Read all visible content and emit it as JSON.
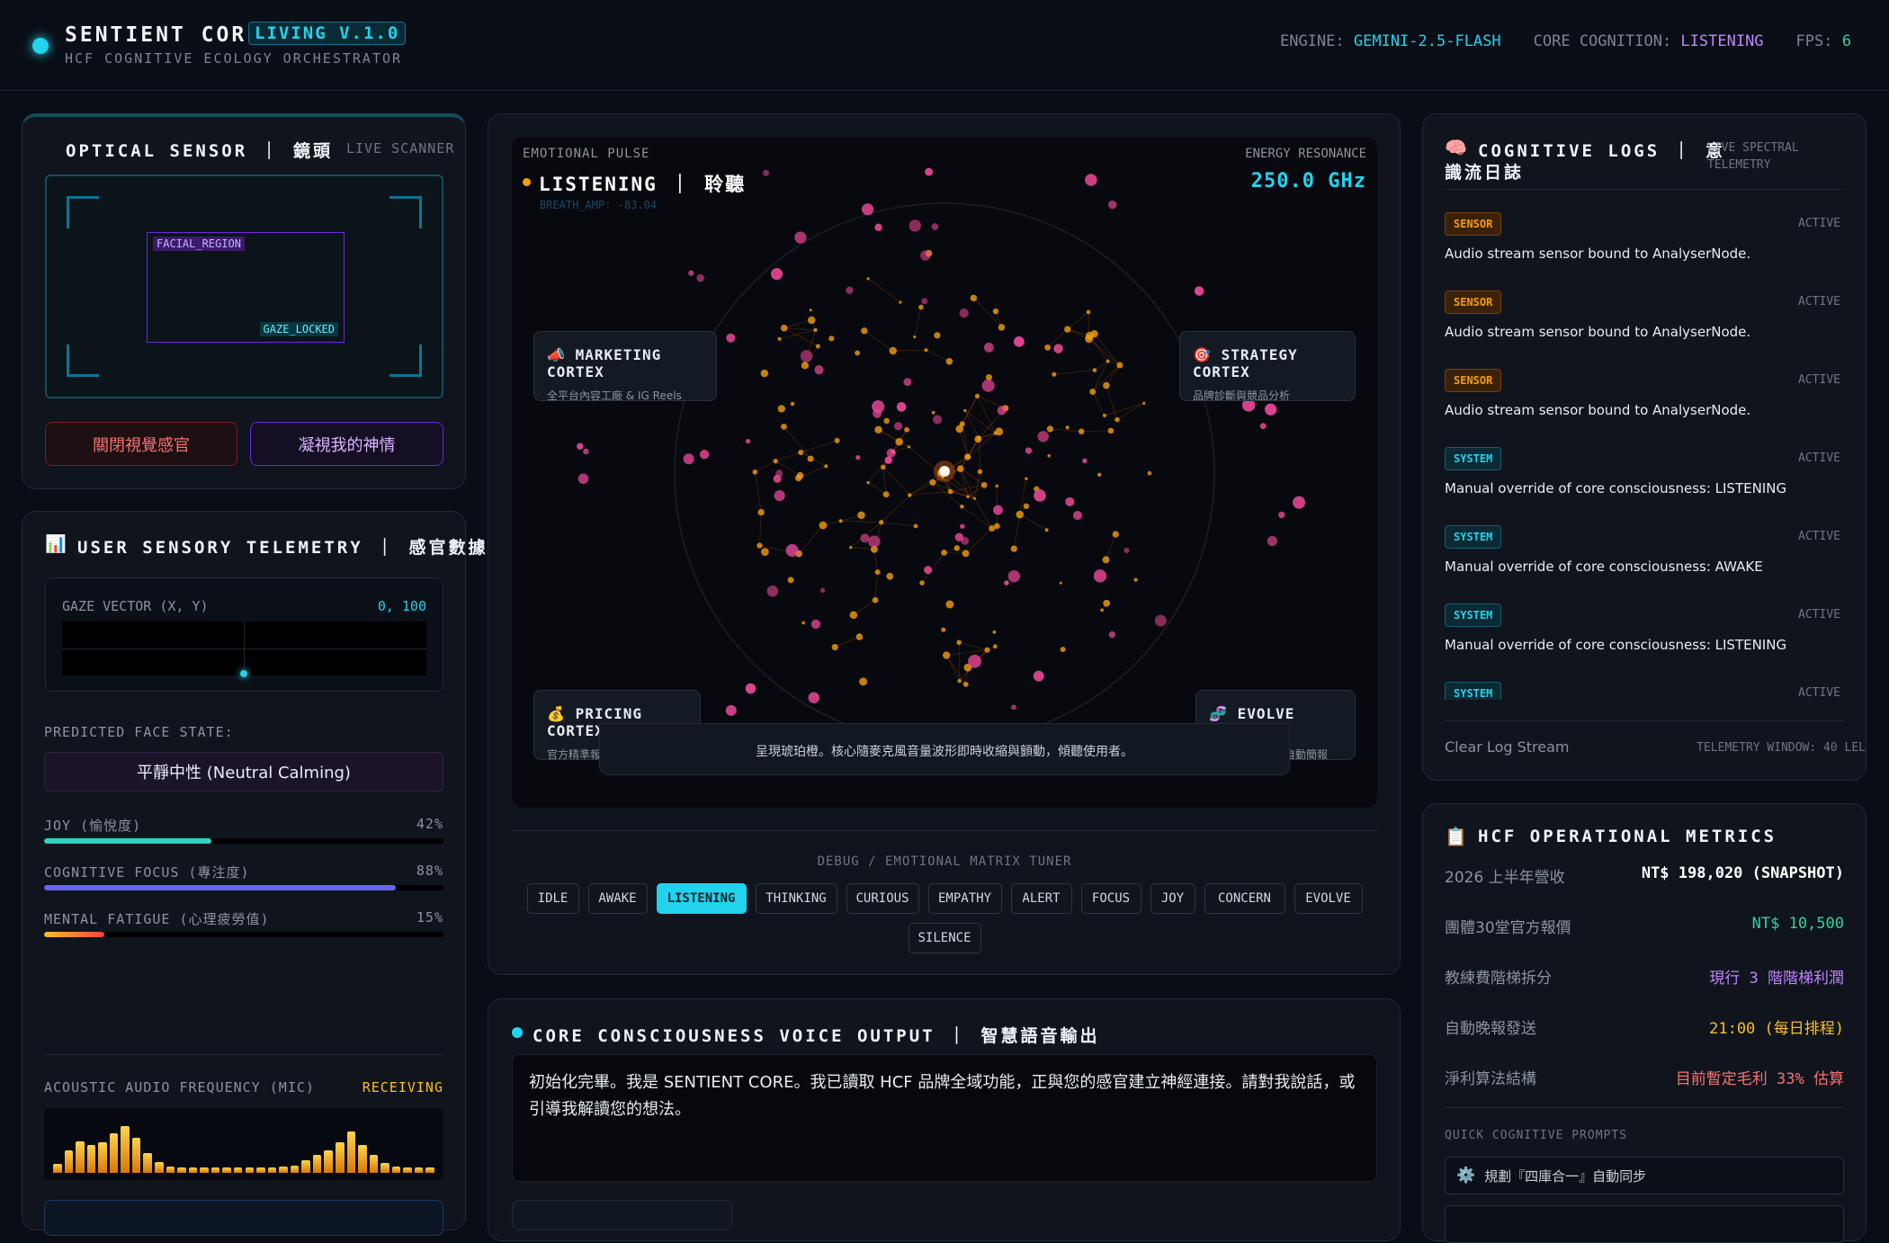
{
  "header": {
    "title": "SENTIENT CORE",
    "version_badge": "LIVING V.1.0",
    "subtitle": "HCF COGNITIVE ECOLOGY ORCHESTRATOR",
    "engine_label": "ENGINE:",
    "engine_value": "GEMINI-2.5-FLASH",
    "cognition_label": "CORE COGNITION:",
    "cognition_value": "LISTENING",
    "fps_label": "FPS:",
    "fps_value": "6"
  },
  "optical": {
    "title": "OPTICAL SENSOR ｜ 鏡頭",
    "subtitle": "LIVE SCANNER",
    "face_tag": "FACIAL_REGION",
    "gaze_tag": "GAZE_LOCKED",
    "close_button": "關閉視覺感官",
    "gaze_button": "凝視我的神情"
  },
  "telemetry": {
    "title": "USER SENSORY TELEMETRY ｜ 感官數據",
    "gaze_label": "GAZE VECTOR (X, Y)",
    "gaze_value": "0, 100",
    "face_state_label": "PREDICTED FACE STATE:",
    "face_state_value": "平靜中性 (Neutral Calming)",
    "metrics": [
      {
        "label": "JOY (愉悅度)",
        "value": "42%",
        "fraction": 0.42,
        "color": "#2dd4bf"
      },
      {
        "label": "COGNITIVE FOCUS (專注度)",
        "value": "88%",
        "fraction": 0.88,
        "color": "#6366f1"
      },
      {
        "label": "MENTAL FATIGUE (心理疲勞值)",
        "value": "15%",
        "fraction": 0.15,
        "color": "#f97316"
      }
    ],
    "audio_label": "ACOUSTIC AUDIO FREQUENCY (MIC)",
    "audio_status": "RECEIVING",
    "audio_levels": [
      0.18,
      0.45,
      0.62,
      0.55,
      0.6,
      0.78,
      0.92,
      0.7,
      0.4,
      0.22,
      0.12,
      0.1,
      0.1,
      0.1,
      0.1,
      0.1,
      0.1,
      0.1,
      0.1,
      0.1,
      0.12,
      0.15,
      0.25,
      0.35,
      0.45,
      0.6,
      0.82,
      0.55,
      0.35,
      0.2,
      0.12,
      0.1,
      0.1,
      0.1
    ]
  },
  "center": {
    "pulse_label": "EMOTIONAL PULSE",
    "state": "LISTENING ｜ 聆聽",
    "breath": "BREATH_AMP: -83.04",
    "energy_label": "ENERGY RESONANCE",
    "energy_value": "250.0 GHz",
    "cortex": [
      {
        "title": "MARKETING CORTEX",
        "sub": "全平台內容工廠 & IG Reels",
        "icon": "📣"
      },
      {
        "title": "STRATEGY CORTEX",
        "sub": "品牌診斷與競品分析",
        "icon": "🎯"
      },
      {
        "title": "PRICING CORTEX",
        "sub": "官方精準報價與教練費算法",
        "icon": "💰"
      },
      {
        "title": "EVOLVE CORTEX",
        "sub": "自學引擎與每日自動簡報",
        "icon": "🧬"
      }
    ],
    "caption": "呈現琥珀橙。核心隨麥克風音量波形即時收縮與顫動，傾聽使用者。",
    "tuner_label": "DEBUG / EMOTIONAL MATRIX TUNER",
    "tuner_buttons": [
      "IDLE",
      "AWAKE",
      "LISTENING",
      "THINKING",
      "CURIOUS",
      "EMPATHY",
      "ALERT",
      "FOCUS",
      "JOY",
      "CONCERN",
      "EVOLVE",
      "SILENCE"
    ],
    "tuner_active": "LISTENING"
  },
  "voice": {
    "title": "CORE CONSCIOUSNESS VOICE OUTPUT ｜ 智慧語音輸出",
    "text": "初始化完畢。我是 SENTIENT CORE。我已讀取 HCF 品牌全域功能，正與您的感官建立神經連接。請對我說話，或引導我解讀您的想法。"
  },
  "logs": {
    "title_line1": "COGNITIVE LOGS ｜ 意",
    "title_line2": "識流日誌",
    "subtitle_line1": "LIVE SPECTRAL",
    "subtitle_line2": "TELEMETRY",
    "entries": [
      {
        "tag": "SENSOR",
        "status": "ACTIVE",
        "text": "Audio stream sensor bound to AnalyserNode."
      },
      {
        "tag": "SENSOR",
        "status": "ACTIVE",
        "text": "Audio stream sensor bound to AnalyserNode."
      },
      {
        "tag": "SENSOR",
        "status": "ACTIVE",
        "text": "Audio stream sensor bound to AnalyserNode."
      },
      {
        "tag": "SYSTEM",
        "status": "ACTIVE",
        "text": "Manual override of core consciousness: LISTENING"
      },
      {
        "tag": "SYSTEM",
        "status": "ACTIVE",
        "text": "Manual override of core consciousness: AWAKE"
      },
      {
        "tag": "SYSTEM",
        "status": "ACTIVE",
        "text": "Manual override of core consciousness: LISTENING"
      },
      {
        "tag": "SYSTEM",
        "status": "ACTIVE",
        "text": ""
      }
    ],
    "clear_button": "Clear Log Stream",
    "window_label": "TELEMETRY WINDOW: 40 LEL"
  },
  "metrics": {
    "title": "HCF OPERATIONAL METRICS",
    "rows": [
      {
        "k": "2026 上半年營收",
        "v": "NT$ 198,020 (SNAPSHOT)",
        "color": "#ffffff"
      },
      {
        "k": "團體30堂官方報價",
        "v": "NT$ 10,500",
        "color": "#34d399"
      },
      {
        "k": "教練費階梯拆分",
        "v": "現行 3 階階梯利潤",
        "color": "#c084fc"
      },
      {
        "k": "自動晚報發送",
        "v": "21:00 (每日排程)",
        "color": "#fbbf24"
      },
      {
        "k": "淨利算法結構",
        "v": "目前暫定毛利 33% 估算",
        "color": "#f87171"
      }
    ],
    "prompts_label": "QUICK COGNITIVE PROMPTS",
    "prompt_1": "規劃『四庫合一』自動同步"
  }
}
